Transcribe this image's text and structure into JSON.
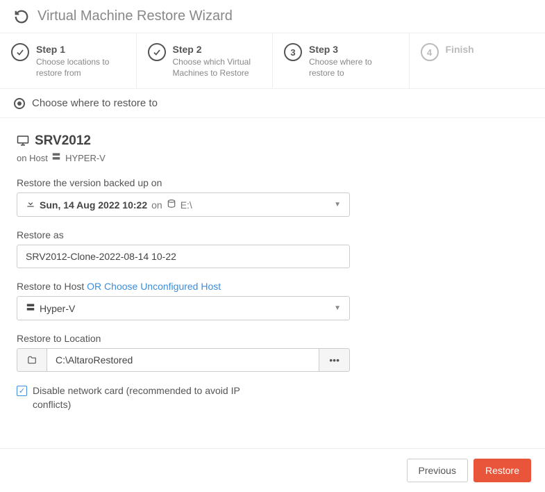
{
  "header": {
    "title": "Virtual Machine Restore Wizard"
  },
  "steps": [
    {
      "title": "Step 1",
      "desc": "Choose locations to restore from"
    },
    {
      "title": "Step 2",
      "desc": "Choose which Virtual Machines to Restore"
    },
    {
      "title": "Step 3",
      "desc": "Choose where to restore to"
    },
    {
      "title": "Finish",
      "desc": ""
    }
  ],
  "subheader": "Choose where to restore to",
  "vm": {
    "name": "SRV2012",
    "host_prefix": "on Host",
    "host_name": "HYPER-V"
  },
  "form": {
    "version_label": "Restore the version backed up on",
    "version_value": "Sun, 14 Aug 2022 10:22",
    "version_on": "on",
    "version_drive": "E:\\",
    "restore_as_label": "Restore as",
    "restore_as_value": "SRV2012-Clone-2022-08-14 10-22",
    "restore_host_label": "Restore to Host",
    "restore_host_link": "OR Choose Unconfigured Host",
    "restore_host_value": "Hyper-V",
    "restore_location_label": "Restore to Location",
    "restore_location_value": "C:\\AltaroRestored",
    "browse_btn": "•••",
    "disable_net_label": "Disable network card (recommended to avoid IP conflicts)"
  },
  "footer": {
    "previous": "Previous",
    "restore": "Restore"
  }
}
